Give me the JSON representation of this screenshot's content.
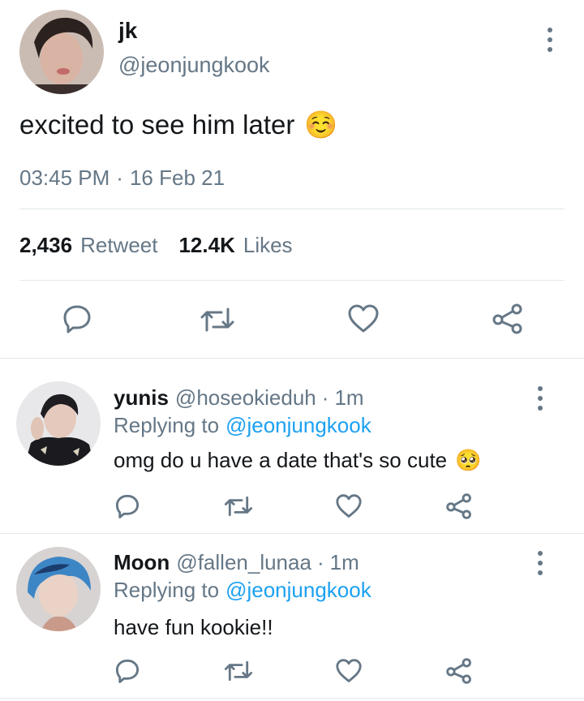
{
  "main_tweet": {
    "display_name": "jk",
    "handle": "@jeonjungkook",
    "text": "excited to see him later",
    "emoji": "☺️",
    "time": "03:45 PM",
    "separator": "·",
    "date": "16 Feb 21",
    "retweet_count": "2,436",
    "retweet_label": "Retweet",
    "like_count": "12.4K",
    "like_label": "Likes"
  },
  "replies": [
    {
      "display_name": "yunis",
      "handle": "@hoseokieduh",
      "separator": "·",
      "time": "1m",
      "replying_label": "Replying to",
      "replying_handle": "@jeonjungkook",
      "text": "omg do u have a date that's so cute",
      "emoji": "🥺"
    },
    {
      "display_name": "Moon",
      "handle": "@fallen_lunaa",
      "separator": "·",
      "time": "1m",
      "replying_label": "Replying to",
      "replying_handle": "@jeonjungkook",
      "text": "have fun kookie!!",
      "emoji": ""
    }
  ],
  "icons": {
    "reply": "reply-icon",
    "retweet": "retweet-icon",
    "like": "heart-icon",
    "share": "share-icon",
    "more": "more-vertical-icon"
  },
  "colors": {
    "text": "#14171a",
    "muted": "#657786",
    "link": "#1da1f2",
    "divider": "#e1e8ed"
  }
}
